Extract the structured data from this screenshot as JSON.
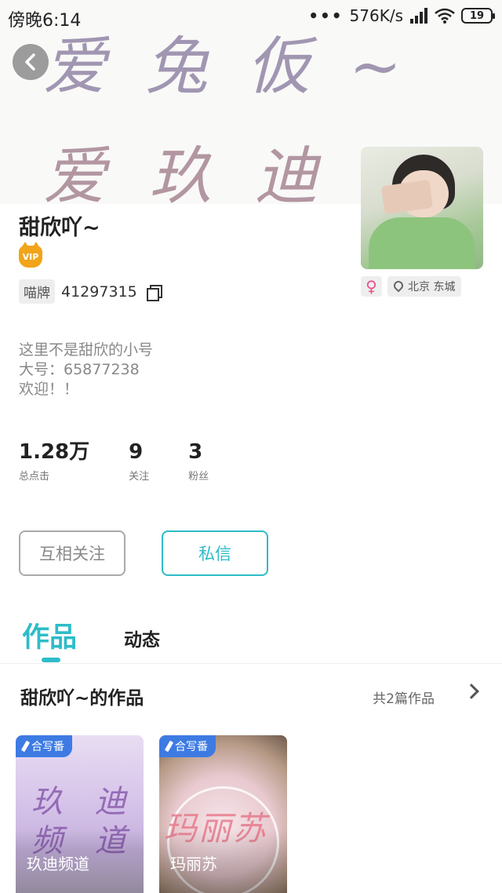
{
  "status_bar": {
    "time": "傍晚6:14",
    "dots": "•••",
    "network_speed": "576K/s",
    "battery": "19"
  },
  "header": {
    "calligraphy_line1": "爱兔仮~",
    "calligraphy_line2": "爱玖迪"
  },
  "profile": {
    "name": "甜欣吖~",
    "vip_label": "VIP",
    "id_tag": "喵牌",
    "id_number": "41297315",
    "gender_symbol": "♀",
    "location": "北京 东城",
    "bio": [
      "这里不是甜欣的小号",
      "大号：65877238",
      "欢迎！！"
    ]
  },
  "stats": [
    {
      "value": "1.28万",
      "label": "总点击"
    },
    {
      "value": "9",
      "label": "关注"
    },
    {
      "value": "3",
      "label": "粉丝"
    }
  ],
  "actions": {
    "follow": "互相关注",
    "message": "私信"
  },
  "tabs": {
    "works": "作品",
    "activity": "动态"
  },
  "works": {
    "title": "甜欣吖~的作品",
    "count": "共2篇作品",
    "items": [
      {
        "tag": "合写番",
        "title": "玖迪频道",
        "cover_text": "玖 迪 频 道"
      },
      {
        "tag": "合写番",
        "title": "玛丽苏",
        "cover_text": "玛丽苏"
      }
    ]
  }
}
